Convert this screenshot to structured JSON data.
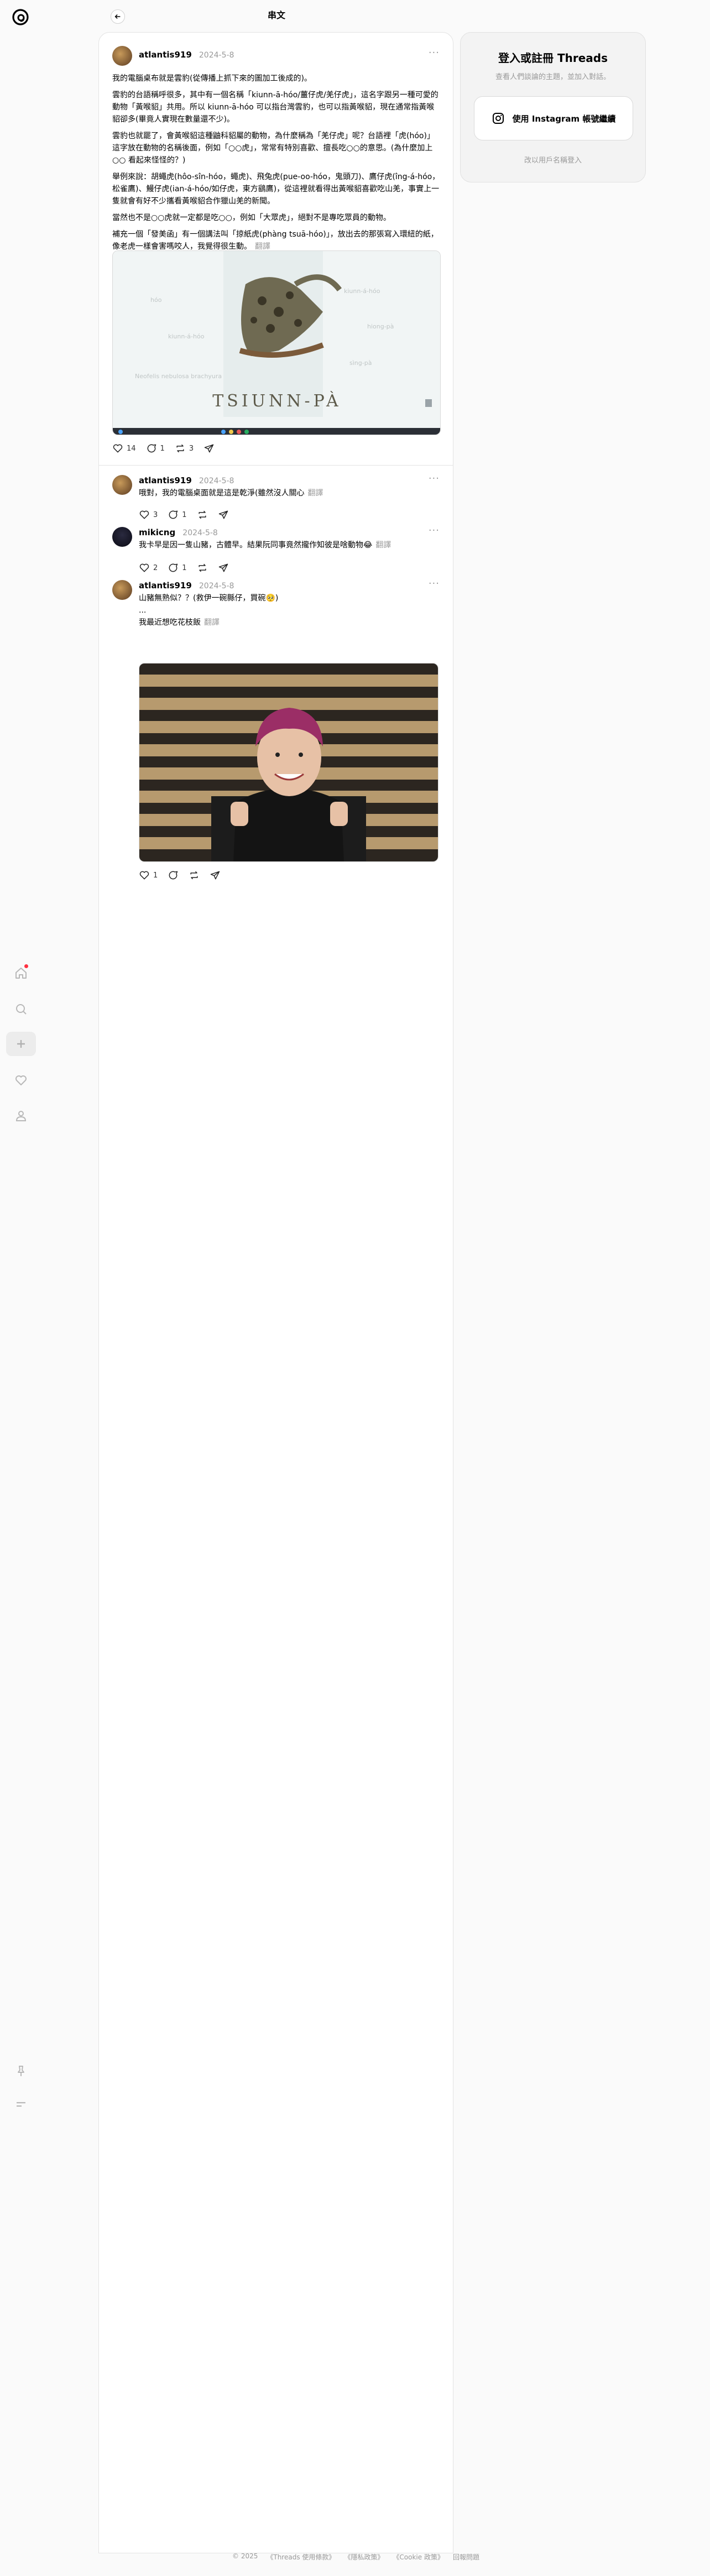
{
  "header": {
    "title": "串文"
  },
  "nav": {
    "items": [
      "home-icon",
      "search-icon",
      "create-icon",
      "heart-icon",
      "profile-icon",
      "pin-icon",
      "menu-icon"
    ]
  },
  "post": {
    "username": "atlantis919",
    "date": "2024-5-8",
    "paragraphs": [
      "我的電腦桌布就是雲豹(從傳播上抓下來的圖加工後成的)。",
      "雲豹的台語稱呼很多，其中有一個名稱「kiunn-ā-hóo/薑仔虎/羌仔虎」，這名字跟另一種可愛的動物「黃喉貂」共用。所以 kiunn-ā-hóo 可以指台灣雲豹，也可以指黃喉貂，現在通常指黃喉貂卻多(畢竟人實現在數量還不少)。",
      "雲豹也就罷了，會黃喉貂這種鼬科貂屬的動物，為什麼稱為「羌仔虎」呢？台語裡「虎(hóo)」這字放在動物的名稱後面，例如「○○虎」，常常有特別喜歡、擅長吃○○的意思。(為什麼加上○○ 看起來怪怪的？)",
      "舉例來說：胡蠅虎(hôo-sîn-hóo，蠅虎)、飛兔虎(pue-oo-hóo，鬼頭刀)、鷹仔虎(îng-á-hóo，松雀鷹)、鰻仔虎(ian-á-hóo/如仔虎，東方鷂鷹)，從這裡就看得出黃喉貂喜歡吃山羌，事實上一隻就會有好不少攜看黃喉貂合作獵山羌的新聞。",
      "當然也不是○○虎就一定都是吃○○，例如「大眾虎」，絕對不是專吃眾員的動物。",
      "補充一個「發美函」有一個講法叫「掠紙虎(phàng tsuā-hóo)」，放出去的那張寫入環紐的紙，像老虎一樣會害嗎咬人，我覺得很生動。"
    ],
    "translate_label": "翻譯",
    "image_caption": "TSIUNN-PÀ",
    "image_labels": [
      "hóo",
      "kiunn-á-hóo",
      "kiunn-á-hóo",
      "Neofelis nebulosa brachyura",
      "sìng-pà",
      "hiong-pà"
    ],
    "likes": "14",
    "comments": "1",
    "reposts": "3"
  },
  "replies": [
    {
      "username": "atlantis919",
      "date": "2024-5-8",
      "text": "哦對，我的電腦桌面就是這是乾淨(雖然沒人關心",
      "translate_label": "翻譯",
      "likes": "3",
      "comments": "1",
      "reposts": ""
    },
    {
      "username": "mikicng",
      "date": "2024-5-8",
      "text": "我卡早是因一隻山豬，古體早。結果阮同事竟然攏作知彼是啥動物😂",
      "translate_label": "翻譯",
      "likes": "2",
      "comments": "1",
      "reposts": ""
    },
    {
      "username": "atlantis919",
      "date": "2024-5-8",
      "text_lines": [
        "山豬無熟似？？(救伊一碗縣仔，買碗🥺)",
        "...",
        "我最近想吃花枝飯"
      ],
      "translate_label": "翻譯",
      "likes": "1",
      "comments": "",
      "reposts": ""
    }
  ],
  "login": {
    "title": "登入或註冊 Threads",
    "subtitle": "查看人們談論的主題，並加入對話。",
    "ig_button": "使用 Instagram 帳號繼續",
    "alt_link": "改以用戶名稱登入"
  },
  "footer": {
    "items": [
      "© 2025",
      "《Threads 使用條款》",
      "《隱私政策》",
      "《Cookie 政策》",
      "回報問題"
    ]
  },
  "colors": {
    "accent_red": "#ff3040",
    "muted": "#999999"
  }
}
